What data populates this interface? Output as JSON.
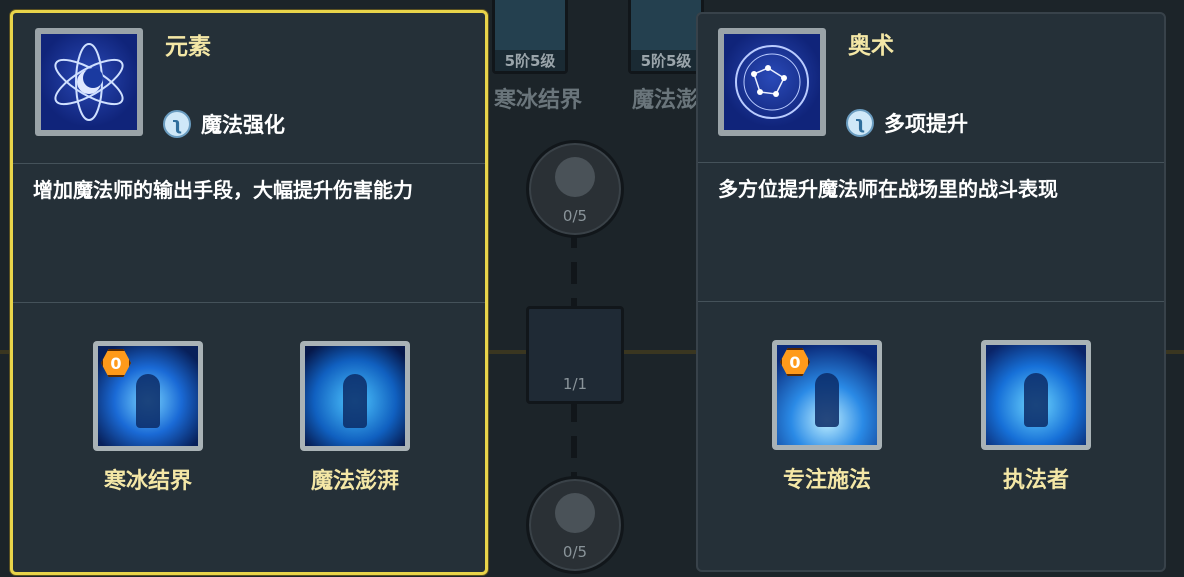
{
  "background": {
    "top_items": [
      {
        "level": "5阶5级",
        "label": "寒冰结界"
      },
      {
        "level": "5阶5级",
        "label": "魔法澎"
      }
    ],
    "nodes": [
      {
        "count": "0/5"
      },
      {
        "count": "1/1"
      },
      {
        "count": "0/5"
      }
    ]
  },
  "panels": [
    {
      "name": "元素",
      "tag": "魔法强化",
      "tag_icon": "staff-icon",
      "description": "增加魔法师的输出手段，大幅提升伤害能力",
      "selected": true,
      "skills": [
        {
          "name": "寒冰结界",
          "badge": "0"
        },
        {
          "name": "魔法澎湃",
          "badge": ""
        }
      ]
    },
    {
      "name": "奥术",
      "tag": "多项提升",
      "tag_icon": "staff-icon",
      "description": "多方位提升魔法师在战场里的战斗表现",
      "selected": false,
      "skills": [
        {
          "name": "专注施法",
          "badge": "0"
        },
        {
          "name": "执法者",
          "badge": ""
        }
      ]
    }
  ],
  "colors": {
    "title": "#f4e7a6",
    "selected_border": "#e8d44a",
    "badge": "#ff9a1a"
  }
}
